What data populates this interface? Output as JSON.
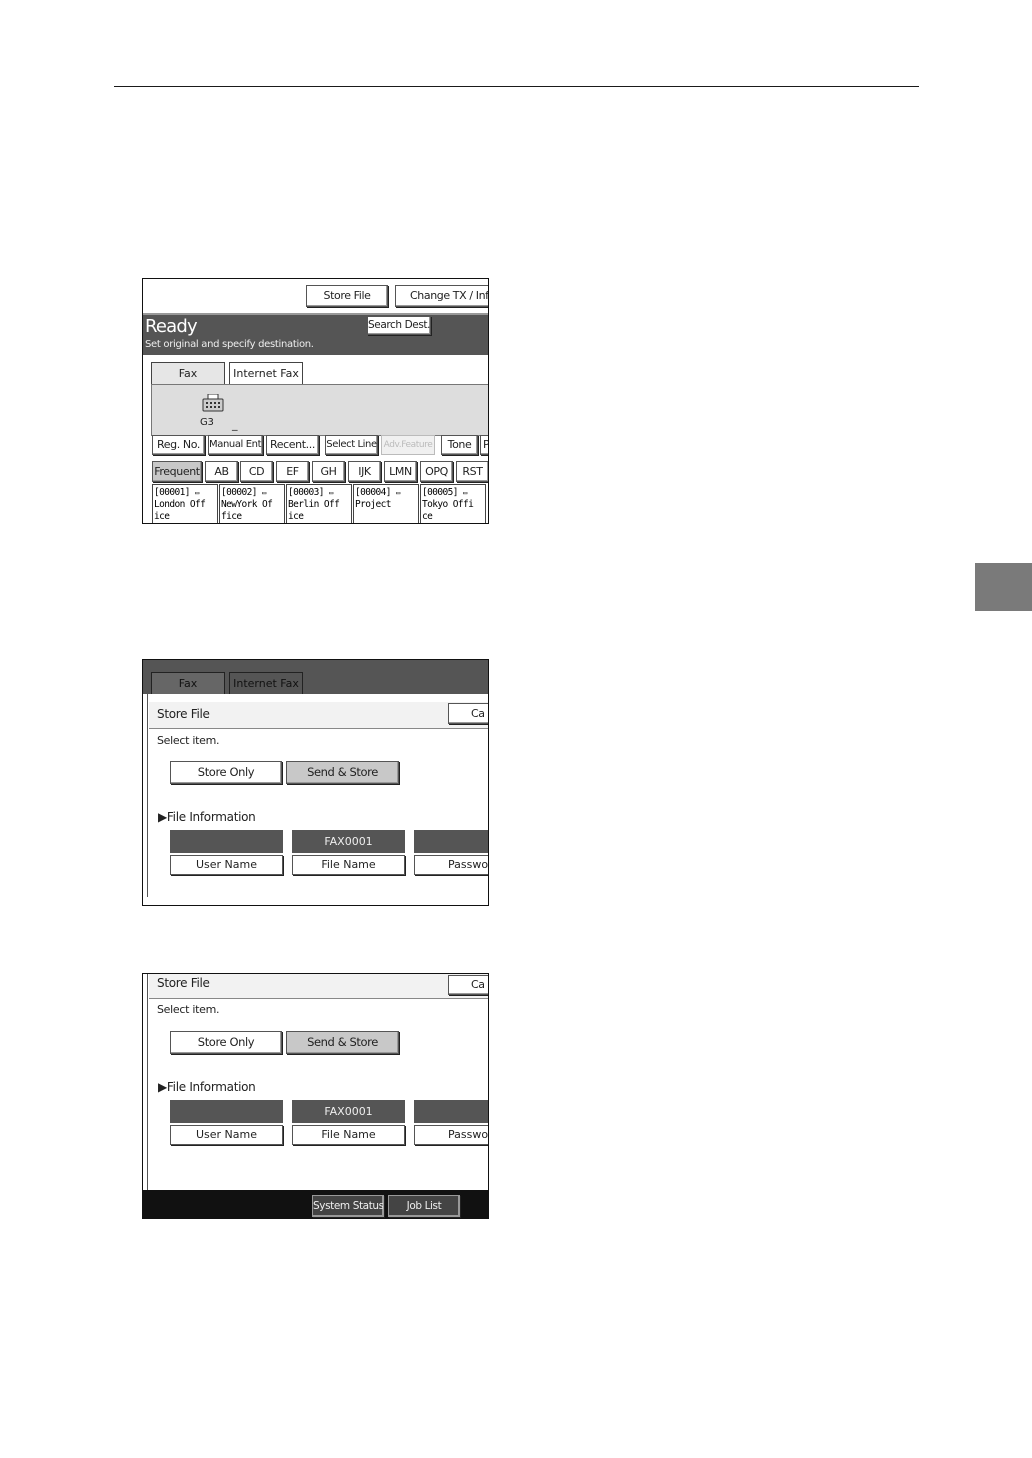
{
  "shot1": {
    "toolbar": {
      "store_file": "Store File",
      "change_tx": "Change TX / Info"
    },
    "status": {
      "title": "Ready",
      "message": "Set original and specify destination.",
      "search_dest": "Search Dest."
    },
    "tabs": [
      "Fax",
      "Internet Fax"
    ],
    "line": {
      "label": "G3",
      "cursor": "_"
    },
    "function_buttons": [
      "Reg. No.",
      "Manual Entry",
      "Recent...",
      "Select Line",
      "Adv.Feature",
      "Tone",
      "P"
    ],
    "index_tabs": [
      "Frequent",
      "AB",
      "CD",
      "EF",
      "GH",
      "IJK",
      "LMN",
      "OPQ",
      "RST"
    ],
    "destinations": [
      {
        "id": "[00001]",
        "name_line1": "London Off",
        "name_line2": "ice"
      },
      {
        "id": "[00002]",
        "name_line1": "NewYork Of",
        "name_line2": "fice"
      },
      {
        "id": "[00003]",
        "name_line1": "Berlin Off",
        "name_line2": "ice"
      },
      {
        "id": "[00004]",
        "name_line1": "Project",
        "name_line2": ""
      },
      {
        "id": "[00005]",
        "name_line1": "Tokyo Offi",
        "name_line2": "ce"
      }
    ]
  },
  "shot2": {
    "tabs": [
      "Fax",
      "Internet Fax"
    ],
    "title": "Store File",
    "cancel": "Ca",
    "instruction": "Select item.",
    "options": [
      "Store Only",
      "Send & Store"
    ],
    "section": "▶File Information",
    "file_info": [
      {
        "value": "",
        "label": "User Name"
      },
      {
        "value": "FAX0001",
        "label": "File Name"
      },
      {
        "value": "",
        "label": "Passwor"
      }
    ]
  },
  "shot3": {
    "title": "Store File",
    "cancel": "Ca",
    "instruction": "Select item.",
    "options": [
      "Store Only",
      "Send & Store"
    ],
    "section": "▶File Information",
    "file_info": [
      {
        "value": "",
        "label": "User Name"
      },
      {
        "value": "FAX0001",
        "label": "File Name"
      },
      {
        "value": "",
        "label": "Passwor"
      }
    ],
    "bottom_buttons": [
      "System Status",
      "Job List"
    ]
  }
}
